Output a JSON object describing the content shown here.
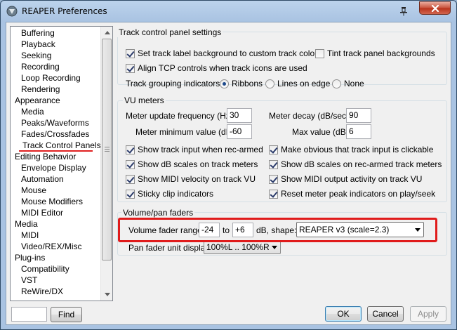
{
  "window": {
    "title": "REAPER Preferences"
  },
  "sidebar": {
    "items": [
      {
        "label": "Buffering",
        "level": 1
      },
      {
        "label": "Playback",
        "level": 1
      },
      {
        "label": "Seeking",
        "level": 1
      },
      {
        "label": "Recording",
        "level": 1
      },
      {
        "label": "Loop Recording",
        "level": 1
      },
      {
        "label": "Rendering",
        "level": 1
      },
      {
        "label": "Appearance",
        "level": 0
      },
      {
        "label": "Media",
        "level": 1
      },
      {
        "label": "Peaks/Waveforms",
        "level": 1
      },
      {
        "label": "Fades/Crossfades",
        "level": 1
      },
      {
        "label": "Track Control Panels",
        "level": 1,
        "selected": true
      },
      {
        "label": "Editing Behavior",
        "level": 0
      },
      {
        "label": "Envelope Display",
        "level": 1
      },
      {
        "label": "Automation",
        "level": 1
      },
      {
        "label": "Mouse",
        "level": 1
      },
      {
        "label": "Mouse Modifiers",
        "level": 1
      },
      {
        "label": "MIDI Editor",
        "level": 1
      },
      {
        "label": "Media",
        "level": 0
      },
      {
        "label": "MIDI",
        "level": 1
      },
      {
        "label": "Video/REX/Misc",
        "level": 1
      },
      {
        "label": "Plug-ins",
        "level": 0
      },
      {
        "label": "Compatibility",
        "level": 1
      },
      {
        "label": "VST",
        "level": 1
      },
      {
        "label": "ReWire/DX",
        "level": 1
      }
    ]
  },
  "find": {
    "value": "",
    "button_label": "Find"
  },
  "tcp": {
    "group_title": "Track control panel settings",
    "set_label_bg": {
      "label": "Set track label background to custom track colors",
      "checked": true
    },
    "tint_bg": {
      "label": "Tint track panel backgrounds",
      "checked": false
    },
    "align_tcp": {
      "label": "Align TCP controls when track icons are used",
      "checked": true
    },
    "grouping_label": "Track grouping indicators:",
    "grouping_options": [
      {
        "label": "Ribbons",
        "checked": true
      },
      {
        "label": "Lines on edge",
        "checked": false
      },
      {
        "label": "None",
        "checked": false
      }
    ]
  },
  "vu": {
    "group_title": "VU meters",
    "update_freq_label": "Meter update frequency (Hz):",
    "update_freq_value": "30",
    "decay_label": "Meter decay (dB/sec):",
    "decay_value": "90",
    "min_label": "Meter minimum value (dB):",
    "min_value": "-60",
    "max_label": "Max value (dB):",
    "max_value": "6",
    "checks": [
      {
        "label": "Show track input when rec-armed",
        "checked": true
      },
      {
        "label": "Make obvious that track input is clickable",
        "checked": true
      },
      {
        "label": "Show dB scales on track meters",
        "checked": true
      },
      {
        "label": "Show dB scales on rec-armed track meters",
        "checked": true
      },
      {
        "label": "Show MIDI velocity on track VU",
        "checked": true
      },
      {
        "label": "Show MIDI output activity on track VU",
        "checked": true
      },
      {
        "label": "Sticky clip indicators",
        "checked": true
      },
      {
        "label": "Reset meter peak indicators on play/seek",
        "checked": true
      }
    ]
  },
  "faders": {
    "group_title": "Volume/pan faders",
    "range_label": "Volume fader range:",
    "range_from": "-24",
    "to_label": "to",
    "range_to": "+6",
    "shape_label": "dB, shape:",
    "shape_value": "REAPER v3 (scale=2.3)",
    "pan_label": "Pan fader unit display:",
    "pan_value": "100%L .. 100%R"
  },
  "buttons": {
    "ok": "OK",
    "cancel": "Cancel",
    "apply": "Apply"
  },
  "colors": {
    "highlight": "#e01b1b",
    "close_button": "#c7503a"
  }
}
